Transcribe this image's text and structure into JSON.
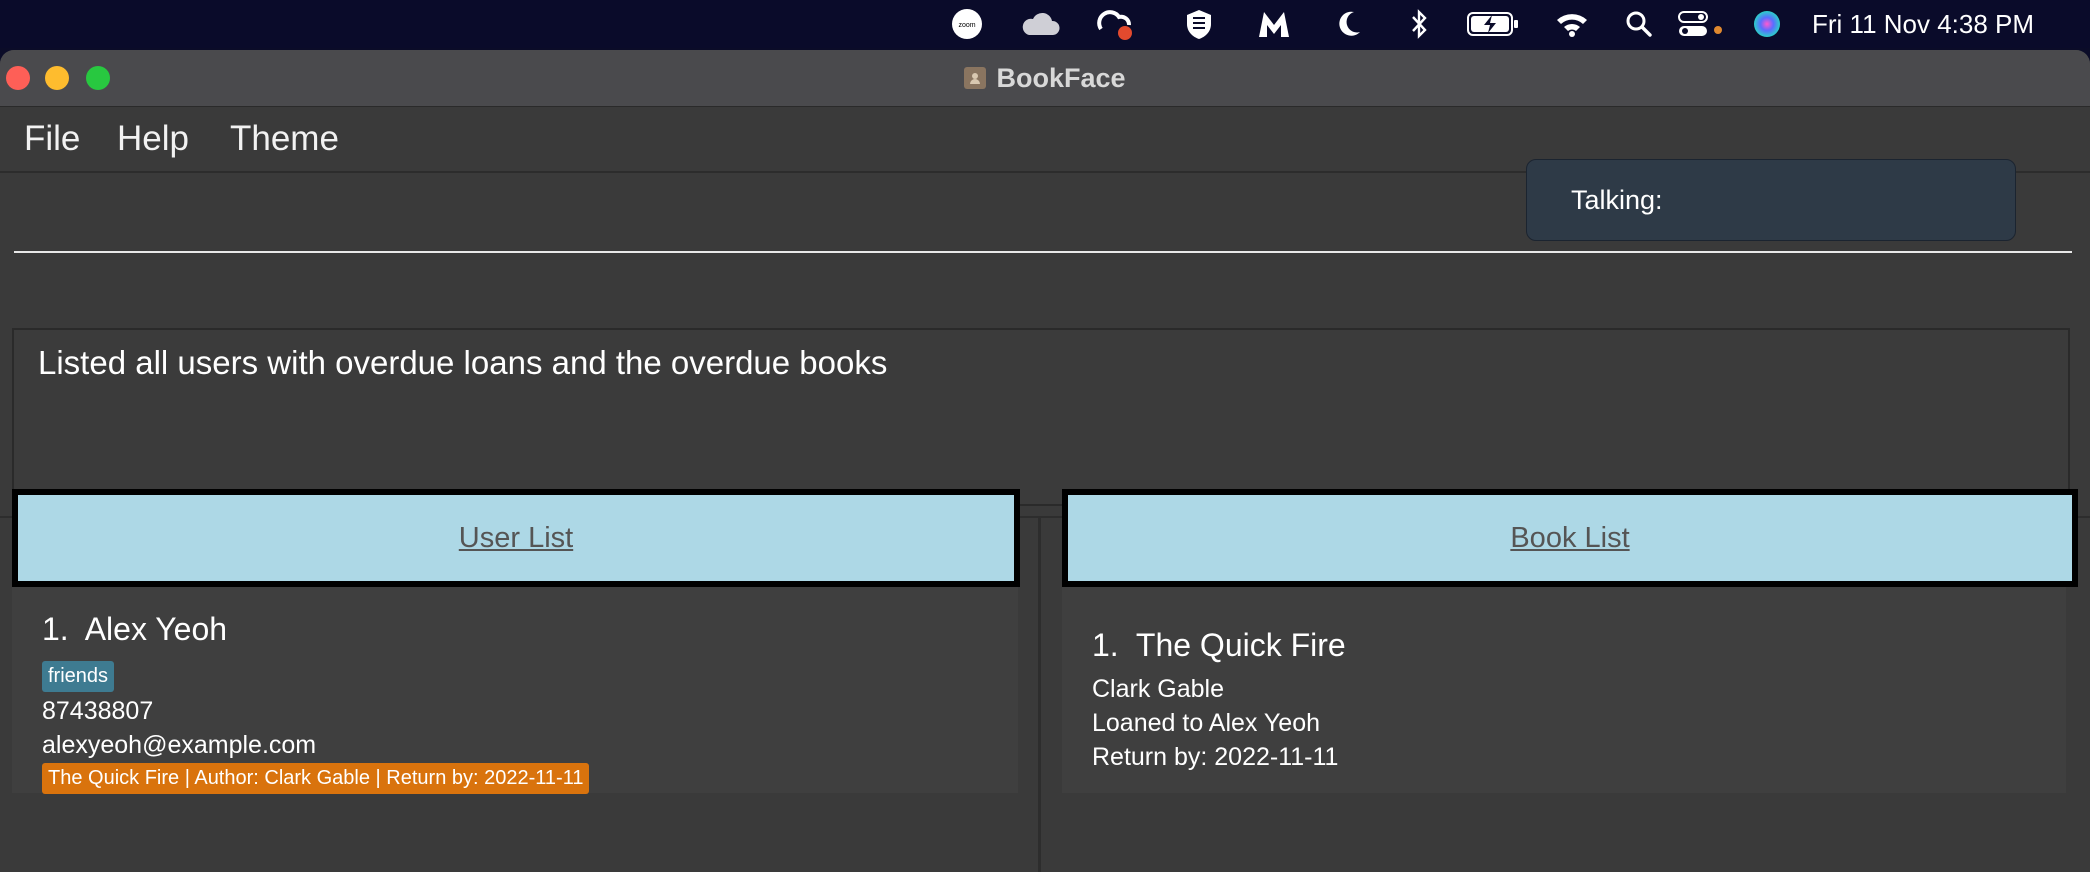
{
  "system_bar": {
    "zoom_label": "zoom",
    "clock": "Fri 11 Nov  4:38 PM"
  },
  "window": {
    "title": "BookFace",
    "menus": [
      "File",
      "Help",
      "Theme"
    ]
  },
  "command": {
    "value": "",
    "talking_label": "Talking:"
  },
  "result": {
    "message": "Listed all users with overdue loans and the overdue books"
  },
  "user_list": {
    "header": "User List",
    "users": [
      {
        "index": "1.",
        "name": "Alex Yeoh",
        "tag": "friends",
        "phone": "87438807",
        "email": "alexyeoh@example.com",
        "loan": "The Quick Fire | Author: Clark Gable | Return by: 2022-11-11"
      }
    ]
  },
  "book_list": {
    "header": "Book List",
    "books": [
      {
        "index": "1.",
        "title": "The Quick Fire",
        "author": "Clark Gable",
        "loaned_to": "Loaned to Alex Yeoh",
        "return_by": "Return by: 2022-11-11"
      }
    ]
  },
  "colors": {
    "header_bg": "#add8e6",
    "tag_bg": "#3e7b91",
    "loan_tag_bg": "#d9730d",
    "talking_bg": "#2e3a47"
  }
}
